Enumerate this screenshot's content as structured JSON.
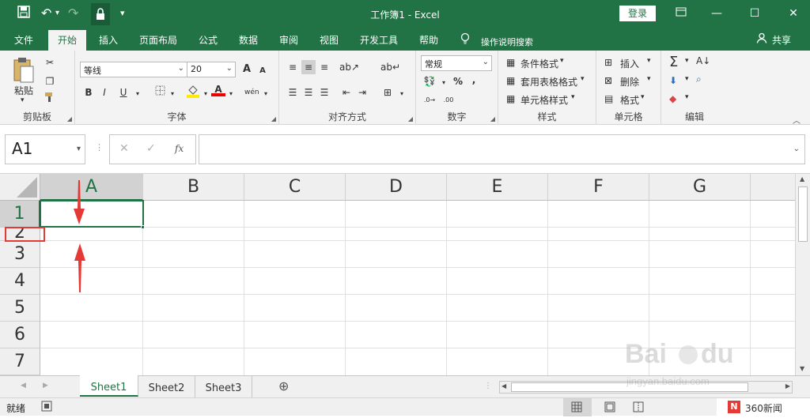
{
  "titlebar": {
    "title": "工作簿1  -  Excel",
    "login": "登录"
  },
  "tabs": [
    "文件",
    "开始",
    "插入",
    "页面布局",
    "公式",
    "数据",
    "审阅",
    "视图",
    "开发工具",
    "帮助"
  ],
  "active_tab": "开始",
  "tell_me": "操作说明搜索",
  "share": "共享",
  "ribbon": {
    "clipboard": {
      "paste": "粘贴",
      "label": "剪贴板"
    },
    "font": {
      "name": "等线",
      "size": "20",
      "label": "字体",
      "bold": "B",
      "italic": "I",
      "underline": "U",
      "grow": "A",
      "shrink": "A",
      "font_color": "A",
      "wen": "wén"
    },
    "alignment": {
      "label": "对齐方式"
    },
    "number": {
      "format": "常规",
      "label": "数字",
      "percent": "%",
      "comma": ","
    },
    "styles": {
      "conditional": "条件格式",
      "table": "套用表格格式",
      "cell": "单元格样式",
      "label": "样式"
    },
    "cells": {
      "insert": "插入",
      "delete": "删除",
      "format": "格式",
      "label": "单元格"
    },
    "editing": {
      "sum": "Σ",
      "label": "编辑"
    }
  },
  "formula_bar": {
    "name_box": "A1",
    "fx": "fx",
    "formula": ""
  },
  "columns": [
    "A",
    "B",
    "C",
    "D",
    "E",
    "F",
    "G"
  ],
  "rows": [
    "1",
    "2",
    "3",
    "4",
    "5",
    "6",
    "7"
  ],
  "selected_cell": "A1",
  "sheets": [
    "Sheet1",
    "Sheet2",
    "Sheet3"
  ],
  "active_sheet": "Sheet1",
  "status": {
    "ready": "就绪"
  },
  "watermark": {
    "news": "360新闻",
    "site": "jingyan.baidu.com"
  },
  "colors": {
    "brand": "#217346",
    "annotation": "#e53935"
  }
}
